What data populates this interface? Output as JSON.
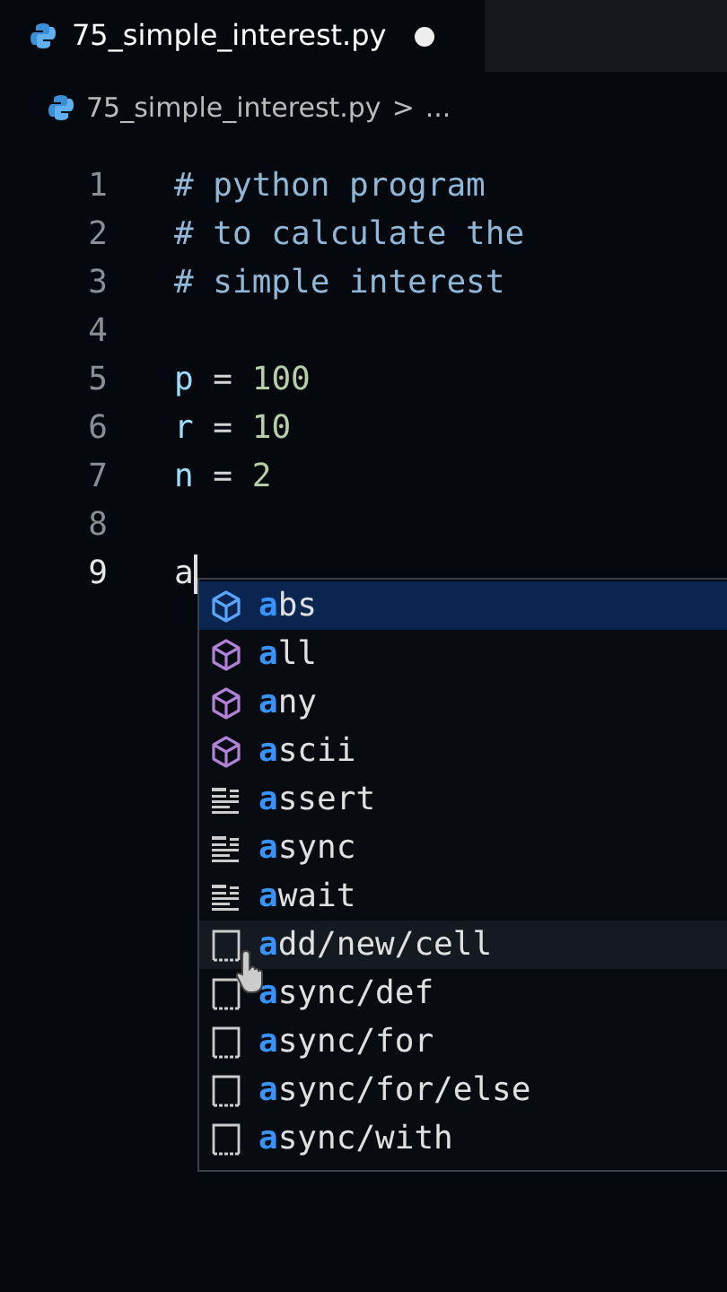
{
  "tab": {
    "title": "75_simple_interest.py",
    "modified": true
  },
  "breadcrumb": {
    "file": "75_simple_interest.py",
    "separator": ">",
    "more": "..."
  },
  "lines": [
    {
      "number": "1",
      "tokens": [
        {
          "kind": "comment",
          "text": "# python program"
        }
      ]
    },
    {
      "number": "2",
      "tokens": [
        {
          "kind": "comment",
          "text": "# to calculate the"
        }
      ]
    },
    {
      "number": "3",
      "tokens": [
        {
          "kind": "comment",
          "text": "# simple interest"
        }
      ]
    },
    {
      "number": "4"
    },
    {
      "number": "5",
      "tokens": [
        {
          "kind": "variable",
          "text": "p"
        },
        {
          "kind": "operator",
          "text": " = "
        },
        {
          "kind": "number",
          "text": "100"
        }
      ]
    },
    {
      "number": "6",
      "tokens": [
        {
          "kind": "variable",
          "text": "r"
        },
        {
          "kind": "operator",
          "text": " = "
        },
        {
          "kind": "number",
          "text": "10"
        }
      ]
    },
    {
      "number": "7",
      "tokens": [
        {
          "kind": "variable",
          "text": "n"
        },
        {
          "kind": "operator",
          "text": " = "
        },
        {
          "kind": "number",
          "text": "2"
        }
      ]
    },
    {
      "number": "8"
    },
    {
      "number": "9",
      "current": true,
      "tokens": [
        {
          "kind": "text",
          "text": "a"
        }
      ]
    }
  ],
  "suggestions": [
    {
      "kind": "function",
      "match": "a",
      "rest": "bs",
      "selected": true,
      "hovered": false
    },
    {
      "kind": "function",
      "match": "a",
      "rest": "ll",
      "selected": false,
      "hovered": false
    },
    {
      "kind": "function",
      "match": "a",
      "rest": "ny",
      "selected": false,
      "hovered": false
    },
    {
      "kind": "function",
      "match": "a",
      "rest": "scii",
      "selected": false,
      "hovered": false
    },
    {
      "kind": "keyword",
      "match": "a",
      "rest": "ssert",
      "selected": false,
      "hovered": false
    },
    {
      "kind": "keyword",
      "match": "a",
      "rest": "sync",
      "selected": false,
      "hovered": false
    },
    {
      "kind": "keyword",
      "match": "a",
      "rest": "wait",
      "selected": false,
      "hovered": false
    },
    {
      "kind": "snippet",
      "match": "a",
      "rest": "dd/new/cell",
      "selected": false,
      "hovered": true
    },
    {
      "kind": "snippet",
      "match": "a",
      "rest": "sync/def",
      "selected": false,
      "hovered": false
    },
    {
      "kind": "snippet",
      "match": "a",
      "rest": "sync/for",
      "selected": false,
      "hovered": false
    },
    {
      "kind": "snippet",
      "match": "a",
      "rest": "sync/for/else",
      "selected": false,
      "hovered": false
    },
    {
      "kind": "snippet",
      "match": "a",
      "rest": "sync/with",
      "selected": false,
      "hovered": false
    }
  ]
}
